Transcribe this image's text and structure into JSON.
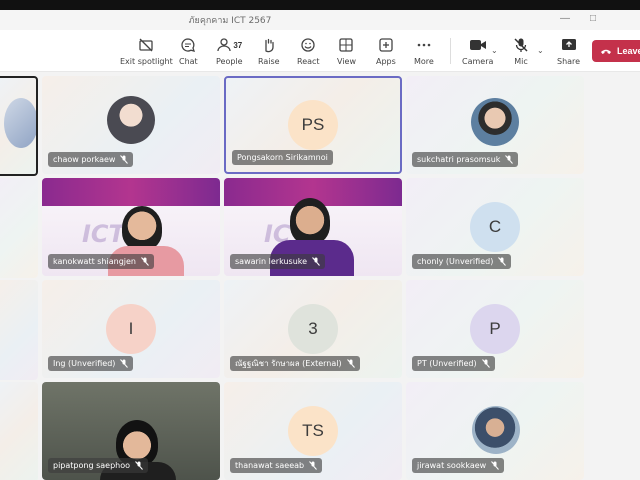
{
  "window": {
    "title": "ภัยคุกคาม ICT 2567"
  },
  "toolbar": {
    "exit_spotlight": "Exit spotlight",
    "chat": "Chat",
    "people": "People",
    "people_count": "37",
    "raise": "Raise",
    "react": "React",
    "view": "View",
    "apps": "Apps",
    "more": "More",
    "camera": "Camera",
    "mic": "Mic",
    "share": "Share",
    "leave": "Leave"
  },
  "participants": [
    {
      "name": "chaow porkaew",
      "kind": "photo",
      "muted": true
    },
    {
      "name": "Pongsakorn Sirikamnoi",
      "initials": "PS",
      "avatar_color": "#fbe3c8",
      "muted": false,
      "active": true
    },
    {
      "name": "sukchatri prasomsuk",
      "kind": "photo",
      "muted": true
    },
    {
      "name": "kanokwatt shiangjen",
      "kind": "video",
      "muted": true
    },
    {
      "name": "sawarin lerkusuke",
      "kind": "video",
      "muted": true
    },
    {
      "name": "chonly (Unverified)",
      "initials": "C",
      "avatar_color": "#cfe0ef",
      "muted": true
    },
    {
      "name": "Ing (Unverified)",
      "initials": "I",
      "avatar_color": "#f6d2c8",
      "muted": true
    },
    {
      "name": "ณัฐฐณิชา รักษาผล (External)",
      "initials": "3",
      "avatar_color": "#dfe3dc",
      "muted": true
    },
    {
      "name": "PT (Unverified)",
      "initials": "P",
      "avatar_color": "#dcd6ee",
      "muted": true
    },
    {
      "name": "pipatpong saephoo",
      "kind": "video",
      "muted": true
    },
    {
      "name": "thanawat saeeab",
      "initials": "TS",
      "avatar_color": "#fbe3c8",
      "muted": true
    },
    {
      "name": "jirawat sookkaew",
      "kind": "photo",
      "muted": true
    }
  ],
  "colors": {
    "accent": "#6b6bc4",
    "leave": "#c4314b",
    "video_banner": "#8a2a8f"
  }
}
